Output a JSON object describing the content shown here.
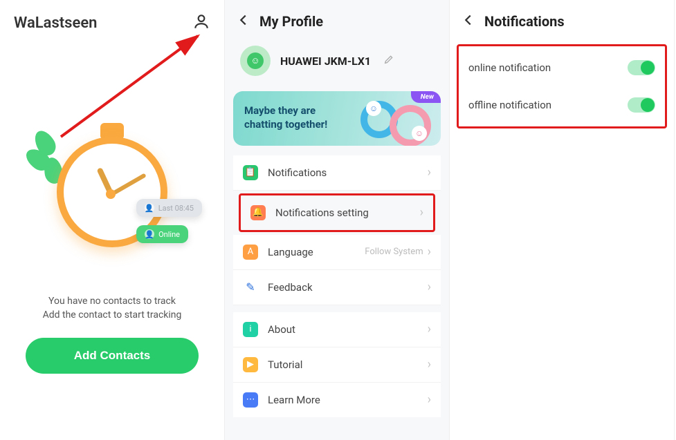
{
  "home": {
    "app_title": "WaLastseen",
    "badge_last": "Last 08:45",
    "badge_online": "Online",
    "empty_l1": "You have no contacts to track",
    "empty_l2": "Add the contact to start tracking",
    "add_btn": "Add Contacts"
  },
  "profile": {
    "title": "My Profile",
    "device_name": "HUAWEI JKM-LX1",
    "promo_l1": "Maybe they are",
    "promo_l2": "chatting together!",
    "promo_badge": "New",
    "items": [
      {
        "label": "Notifications",
        "icon": "notify",
        "hint": ""
      },
      {
        "label": "Notifications setting",
        "icon": "bell",
        "hint": ""
      },
      {
        "label": "Language",
        "icon": "lang",
        "hint": "Follow System"
      },
      {
        "label": "Feedback",
        "icon": "feedback",
        "hint": ""
      },
      {
        "label": "About",
        "icon": "about",
        "hint": ""
      },
      {
        "label": "Tutorial",
        "icon": "tutorial",
        "hint": ""
      },
      {
        "label": "Learn More",
        "icon": "learn",
        "hint": ""
      }
    ]
  },
  "notifications": {
    "title": "Notifications",
    "items": [
      {
        "label": "online notification",
        "on": true
      },
      {
        "label": "offline notification",
        "on": true
      }
    ]
  }
}
